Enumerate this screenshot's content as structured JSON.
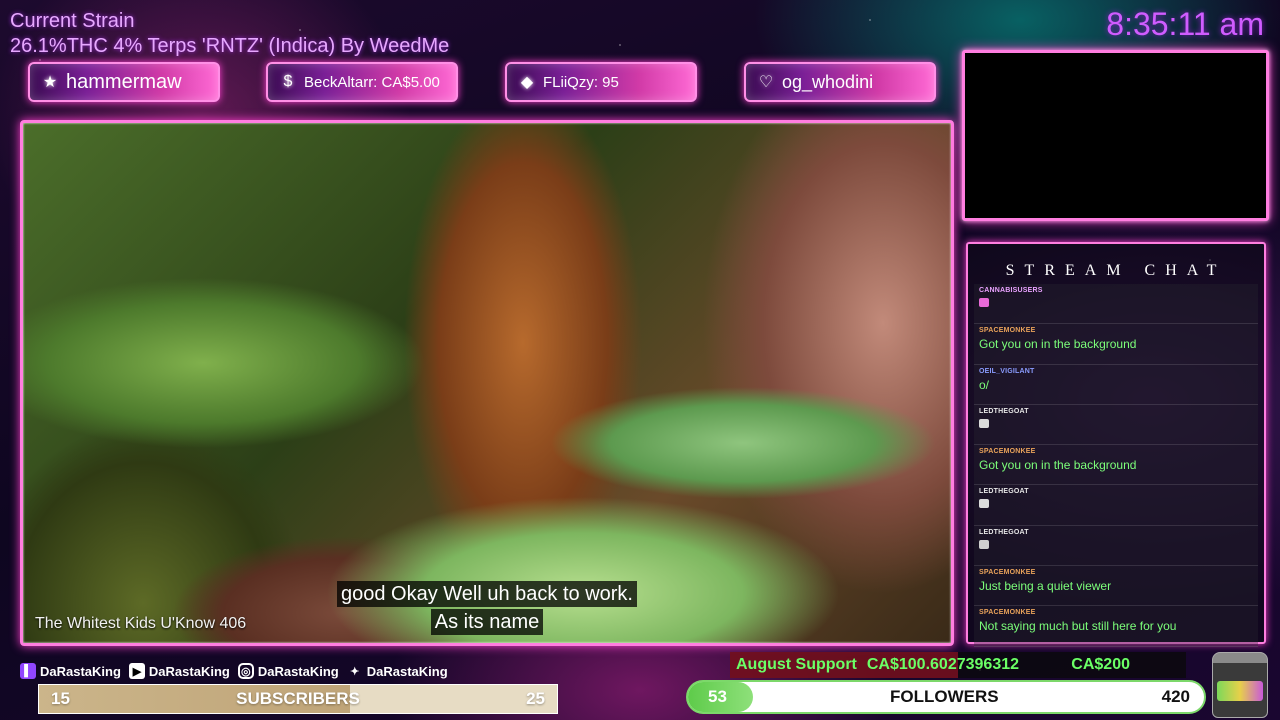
{
  "strain": {
    "title": "Current Strain",
    "info": "26.1%THC 4% Terps 'RNTZ' (Indica) By WeedMe"
  },
  "clock": "8:35:11 am",
  "badges": [
    {
      "icon": "star-icon",
      "glyph": "★",
      "label": "hammermaw"
    },
    {
      "icon": "dollar-icon",
      "glyph": "$",
      "label": "BeckAltarr: CA$5.00"
    },
    {
      "icon": "diamond-icon",
      "glyph": "◆",
      "label": "FLiiQzy: 95"
    },
    {
      "icon": "heart-icon",
      "glyph": "♡",
      "label": "og_whodini"
    }
  ],
  "video": {
    "title": "The Whitest Kids U'Know 406",
    "subtitle_line1": "good Okay Well uh back to work.",
    "subtitle_line2": "As its name"
  },
  "chat": {
    "header": "STREAM CHAT",
    "messages": [
      {
        "user": "CANNABISUSERS",
        "user_color": "#e9a2ff",
        "text": "",
        "emote_color": "#e86ad8"
      },
      {
        "user": "SPACEMONKEE",
        "user_color": "#e8a25a",
        "text": "Got you on in the background",
        "emote_color": ""
      },
      {
        "user": "OEIL_VIGILANT",
        "user_color": "#8a9cff",
        "text": "o/",
        "emote_color": ""
      },
      {
        "user": "LEDTHEGOAT",
        "user_color": "#e6e6e6",
        "text": "",
        "emote_color": "#dcdcdc"
      },
      {
        "user": "SPACEMONKEE",
        "user_color": "#e8a25a",
        "text": "Got you on in the background",
        "emote_color": ""
      },
      {
        "user": "LEDTHEGOAT",
        "user_color": "#e6e6e6",
        "text": "",
        "emote_color": "#dcdcdc"
      },
      {
        "user": "LEDTHEGOAT",
        "user_color": "#e6e6e6",
        "text": "",
        "emote_color": "#cfcfcf"
      },
      {
        "user": "SPACEMONKEE",
        "user_color": "#e8a25a",
        "text": "Just being a quiet viewer",
        "emote_color": ""
      },
      {
        "user": "SPACEMONKEE",
        "user_color": "#e8a25a",
        "text": "Not saying much but still here for you",
        "emote_color": ""
      }
    ]
  },
  "socials": [
    {
      "icon": "twitch-icon",
      "glyph": "▌",
      "handle": "DaRastaKing"
    },
    {
      "icon": "youtube-icon",
      "glyph": "▶",
      "handle": "DaRastaKing"
    },
    {
      "icon": "instagram-icon",
      "glyph": "◎",
      "handle": "DaRastaKing"
    },
    {
      "icon": "twitter-icon",
      "glyph": "✦",
      "handle": "DaRastaKing"
    }
  ],
  "subscribers": {
    "current": "15",
    "label": "SUBSCRIBERS",
    "goal": "25",
    "progress": 0.6
  },
  "august_support": {
    "label": "August Support",
    "current": "CA$100.6027396312",
    "goal": "CA$200",
    "progress": 0.5
  },
  "followers": {
    "current": "53",
    "label": "FOLLOWERS",
    "goal": "420",
    "progress": 0.126
  },
  "colors": {
    "accent": "#ff7ee0",
    "chat_text": "#7cff7a",
    "clock": "#d05cff"
  }
}
